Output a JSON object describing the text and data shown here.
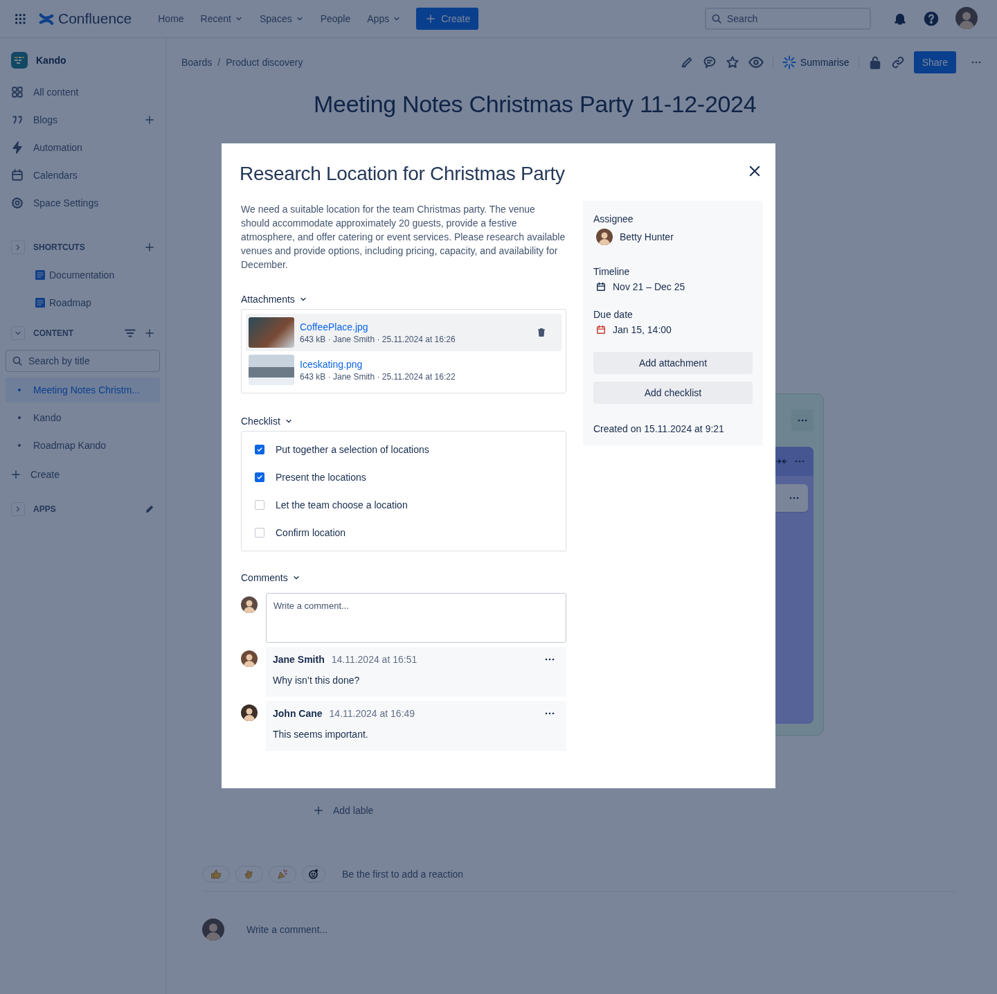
{
  "top_nav": {
    "product": "Confluence",
    "items": [
      {
        "label": "Home",
        "dropdown": false
      },
      {
        "label": "Recent",
        "dropdown": true
      },
      {
        "label": "Spaces",
        "dropdown": true
      },
      {
        "label": "People",
        "dropdown": false
      },
      {
        "label": "Apps",
        "dropdown": true
      }
    ],
    "create_button": "Create",
    "search": {
      "placeholder": "Search"
    }
  },
  "sidebar": {
    "space": "Kando",
    "items": [
      {
        "label": "All content",
        "kind": "grid",
        "add": false
      },
      {
        "label": "Blogs",
        "kind": "quote",
        "add": true
      },
      {
        "label": "Automation",
        "kind": "bolt",
        "add": false
      },
      {
        "label": "Calendars",
        "kind": "calendar",
        "add": false
      },
      {
        "label": "Space Settings",
        "kind": "gear",
        "add": false
      }
    ],
    "shortcuts": {
      "heading": "SHORTCUTS",
      "expanded": false,
      "items": [
        "Documentation",
        "Roadmap"
      ]
    },
    "content": {
      "heading": "CONTENT",
      "expanded": true,
      "search": {
        "placeholder": "Search by title"
      },
      "pages": [
        {
          "label": "Meeting Notes Christm...",
          "selected": true
        },
        {
          "label": "Kando",
          "selected": false
        },
        {
          "label": "Roadmap Kando",
          "selected": false
        }
      ],
      "create": "Create"
    },
    "apps": {
      "heading": "APPS",
      "expanded": false
    }
  },
  "page": {
    "breadcrumbs": {
      "separator": "/",
      "items": [
        "Boards",
        "Product discovery"
      ]
    },
    "summarise": "Summarise",
    "share": "Share",
    "title": "Meeting Notes Christmas Party 11-12-2024",
    "add_label": "Add lable",
    "reactions": {
      "prompt": "Be the first to add a reaction"
    },
    "comment": {
      "placeholder": "Write a comment..."
    }
  },
  "modal": {
    "title": "Research Location for Christmas Party",
    "description": "We need a suitable location for the team Christmas party. The venue should accommodate approximately 20 guests, provide a festive atmosphere, and offer catering or event services. Please research available venues and provide options, including pricing, capacity, and availability for December.",
    "attachments": {
      "heading": "Attachments",
      "expanded": true,
      "files": [
        {
          "name": "CoffeePlace.jpg",
          "meta": "643 kB · Jane Smith · 25.11.2024 at 16:26",
          "hovered": true
        },
        {
          "name": "Iceskating.png",
          "meta": "643 kB · Jane Smith · 25.11.2024 at 16:22",
          "hovered": false
        }
      ]
    },
    "checklist": {
      "heading": "Checklist",
      "expanded": true,
      "items": [
        {
          "label": "Put together a selection of locations",
          "checked": true
        },
        {
          "label": "Present the locations",
          "checked": true
        },
        {
          "label": "Let the team choose a location",
          "checked": false
        },
        {
          "label": "Confirm location",
          "checked": false
        }
      ]
    },
    "comments": {
      "heading": "Comments",
      "expanded": true,
      "input": {
        "placeholder": "Write a comment..."
      },
      "items": [
        {
          "author": "Jane Smith",
          "time": "14.11.2024 at 16:51",
          "text": "Why isn’t this done?"
        },
        {
          "author": "John Cane",
          "time": "14.11.2024 at 16:49",
          "text": "This seems important."
        }
      ]
    },
    "details": {
      "assignee_label": "Assignee",
      "assignee": "Betty Hunter",
      "timeline_label": "Timeline",
      "timeline": "Nov 21 – Dec 25",
      "due_label": "Due date",
      "due": "Jan 15, 14:00",
      "buttons": [
        "Add attachment",
        "Add checklist"
      ],
      "created": "Created on 15.11.2024 at 9:21"
    }
  }
}
